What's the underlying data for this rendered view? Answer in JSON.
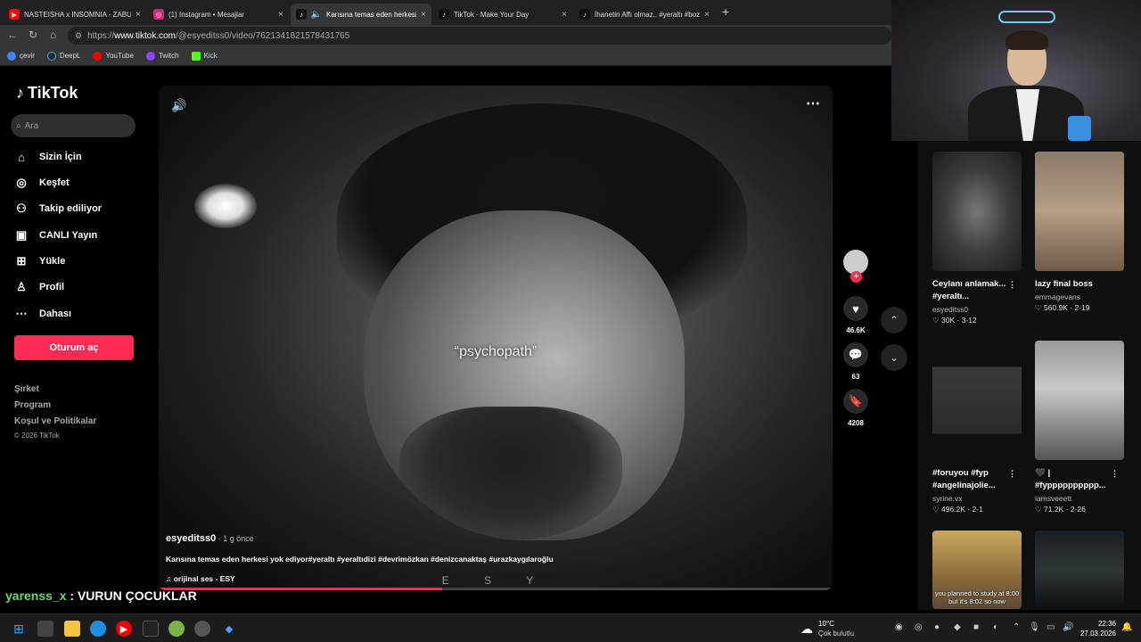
{
  "tabs": [
    {
      "title": "NASTEISHA x INSOMNIA - ZABUTO",
      "icon": "youtube-icon",
      "color": "#ff0000",
      "close": "×"
    },
    {
      "title": "(1) Instagram • Mesajlar",
      "icon": "instagram-icon",
      "color": "#d62976",
      "close": "×"
    },
    {
      "title": "Karısına temas eden herkesi y",
      "icon": "tiktok-icon",
      "color": "#111111",
      "close": "×"
    },
    {
      "title": "TikTok - Make Your Day",
      "icon": "tiktok-icon",
      "color": "#111111",
      "close": "×"
    },
    {
      "title": "İhanetin Affı olmaz.. #yeraltı #bozk",
      "icon": "tiktok-icon",
      "color": "#111111",
      "close": "×"
    }
  ],
  "new_tab": "+",
  "url": {
    "domain": "www.tiktok.com",
    "path": "/@esyeditss0/video/7621341821578431765"
  },
  "bookmarks": [
    {
      "label": "çevir",
      "icon": "google-icon",
      "color": "#4285f4"
    },
    {
      "label": "DeepL",
      "icon": "deepl-icon",
      "color": "#0f2b46"
    },
    {
      "label": "YouTube",
      "icon": "youtube-icon",
      "color": "#ff0000"
    },
    {
      "label": "Twitch",
      "icon": "twitch-icon",
      "color": "#9146ff"
    },
    {
      "label": "Kick",
      "icon": "kick-icon",
      "color": "#53fc18"
    }
  ],
  "sidebar": {
    "logo": "TikTok",
    "search_placeholder": "Ara",
    "items": [
      {
        "label": "Sizin İçin",
        "icon": "home-icon"
      },
      {
        "label": "Keşfet",
        "icon": "compass-icon"
      },
      {
        "label": "Takip ediliyor",
        "icon": "following-icon"
      },
      {
        "label": "CANLI Yayın",
        "icon": "live-icon"
      },
      {
        "label": "Yükle",
        "icon": "upload-icon"
      },
      {
        "label": "Profil",
        "icon": "profile-icon"
      },
      {
        "label": "Dahası",
        "icon": "more-icon"
      }
    ],
    "login": "Oturum aç",
    "footer": [
      "Şirket",
      "Program",
      "Koşul ve Politikalar"
    ],
    "copyright": "© 2026 TikTok"
  },
  "video": {
    "caption_overlay": "“psychopath”",
    "watermark": "E S Y",
    "username": "esyeditss0",
    "time_ago": " · 1 g önce",
    "description": "Karısına temas eden herkesi yok ediyor#yeraltı #yeraltıdizi #devrimözkan #denizcanaktaş #urazkaygılaroğlu",
    "music": "♫  orijinal ses - ESY",
    "progress": 0.42,
    "likes": "46.6K",
    "comments": "63",
    "saves": "4208"
  },
  "recommended": [
    {
      "title": "Ceylanı anlamak... #yeraltı...",
      "user": "esyeditss0",
      "likes": "30K",
      "date": "3-12"
    },
    {
      "title": "lazy final boss",
      "user": "emmagevans",
      "likes": "560.9K",
      "date": "2-19"
    },
    {
      "title": "#foruyou #fyp #angelinajolie...",
      "user": "syrine.vx",
      "likes": "496.2K",
      "date": "2-1"
    },
    {
      "title": "🖤 |  #fypppppppppp...",
      "user": "iamsveeett",
      "likes": "71.2K",
      "date": "2-26"
    },
    {
      "title": "",
      "user": "",
      "likes": "",
      "date": "",
      "thumb_text": "you planned to study at 8:00 but it's 8:02 so now"
    },
    {
      "title": "",
      "user": "",
      "likes": "",
      "date": ""
    }
  ],
  "chat": {
    "user": "yarenss_x",
    "message": " : VURUN ÇOCUKLAR"
  },
  "taskbar": {
    "temp": "10°C",
    "weather": "Çok bulutlu",
    "time": "22:36",
    "date": "27.03.2026"
  }
}
